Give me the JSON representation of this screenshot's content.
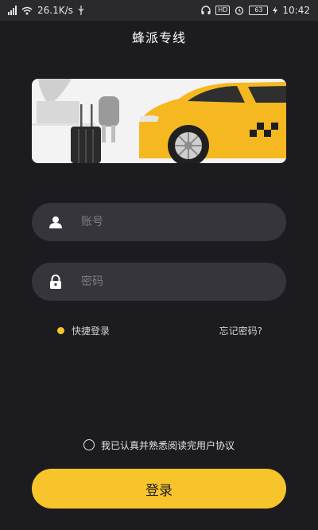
{
  "status_bar": {
    "net_speed": "26.1K/s",
    "battery": "63",
    "hd_label": "HD",
    "time": "10:42",
    "icons": [
      "signal-icon",
      "wifi-icon",
      "usb-icon",
      "headphones-icon",
      "hd-icon",
      "alarm-icon",
      "battery-icon",
      "charging-icon"
    ]
  },
  "header": {
    "title": "蜂派专线"
  },
  "form": {
    "account_placeholder": "账号",
    "account_value": "",
    "password_placeholder": "密码",
    "password_value": ""
  },
  "options": {
    "quick_login": "快捷登录",
    "forgot_password": "忘记密码?"
  },
  "agreement": {
    "text": "我已认真并熟悉阅读完用户协议",
    "checked": false
  },
  "actions": {
    "login": "登录"
  },
  "colors": {
    "background": "#1c1c20",
    "field": "#35353b",
    "accent": "#f7c42b",
    "status_bar": "#2a2a2e"
  }
}
